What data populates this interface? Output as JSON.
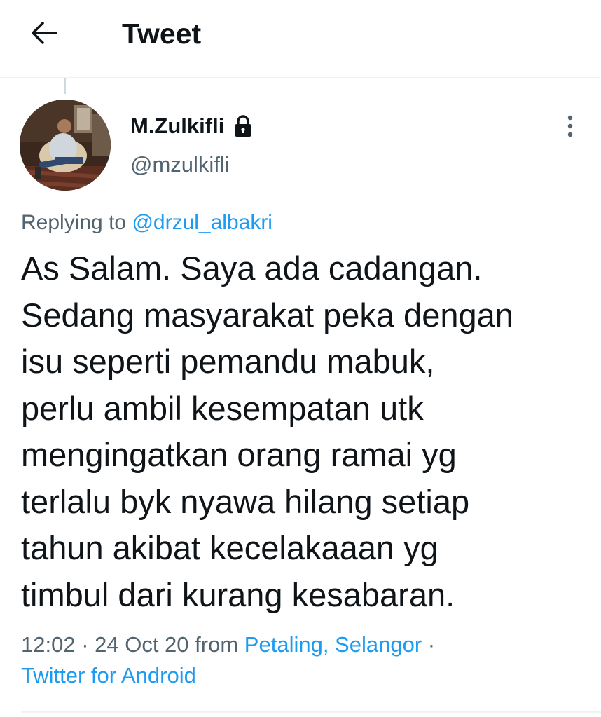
{
  "header": {
    "title": "Tweet",
    "back_icon": "arrow-left-icon"
  },
  "tweet": {
    "author_name": "M.Zulkifli",
    "protected_icon": "lock-icon",
    "author_handle": "@mzulkifli",
    "more_icon": "more-vertical-icon",
    "replying_prefix": "Replying to",
    "replying_handle": "@drzul_albakri",
    "text_lines": [
      "As Salam. Saya ada cadangan.",
      "Sedang masyarakat peka dengan",
      "isu seperti pemandu mabuk,",
      "perlu ambil kesempatan utk",
      "mengingatkan orang ramai yg",
      "terlalu byk nyawa hilang setiap",
      "tahun akibat kecelakaaan yg",
      "timbul dari kurang kesabaran."
    ],
    "timestamp": "12:02 · 24 Oct 20",
    "from_label": "from",
    "location": "Petaling, Selangor",
    "separator": "·",
    "source": "Twitter for Android"
  },
  "colors": {
    "text_primary": "#0f1419",
    "text_secondary": "#536471",
    "link": "#1d9bf0",
    "divider": "#eff3f4"
  }
}
